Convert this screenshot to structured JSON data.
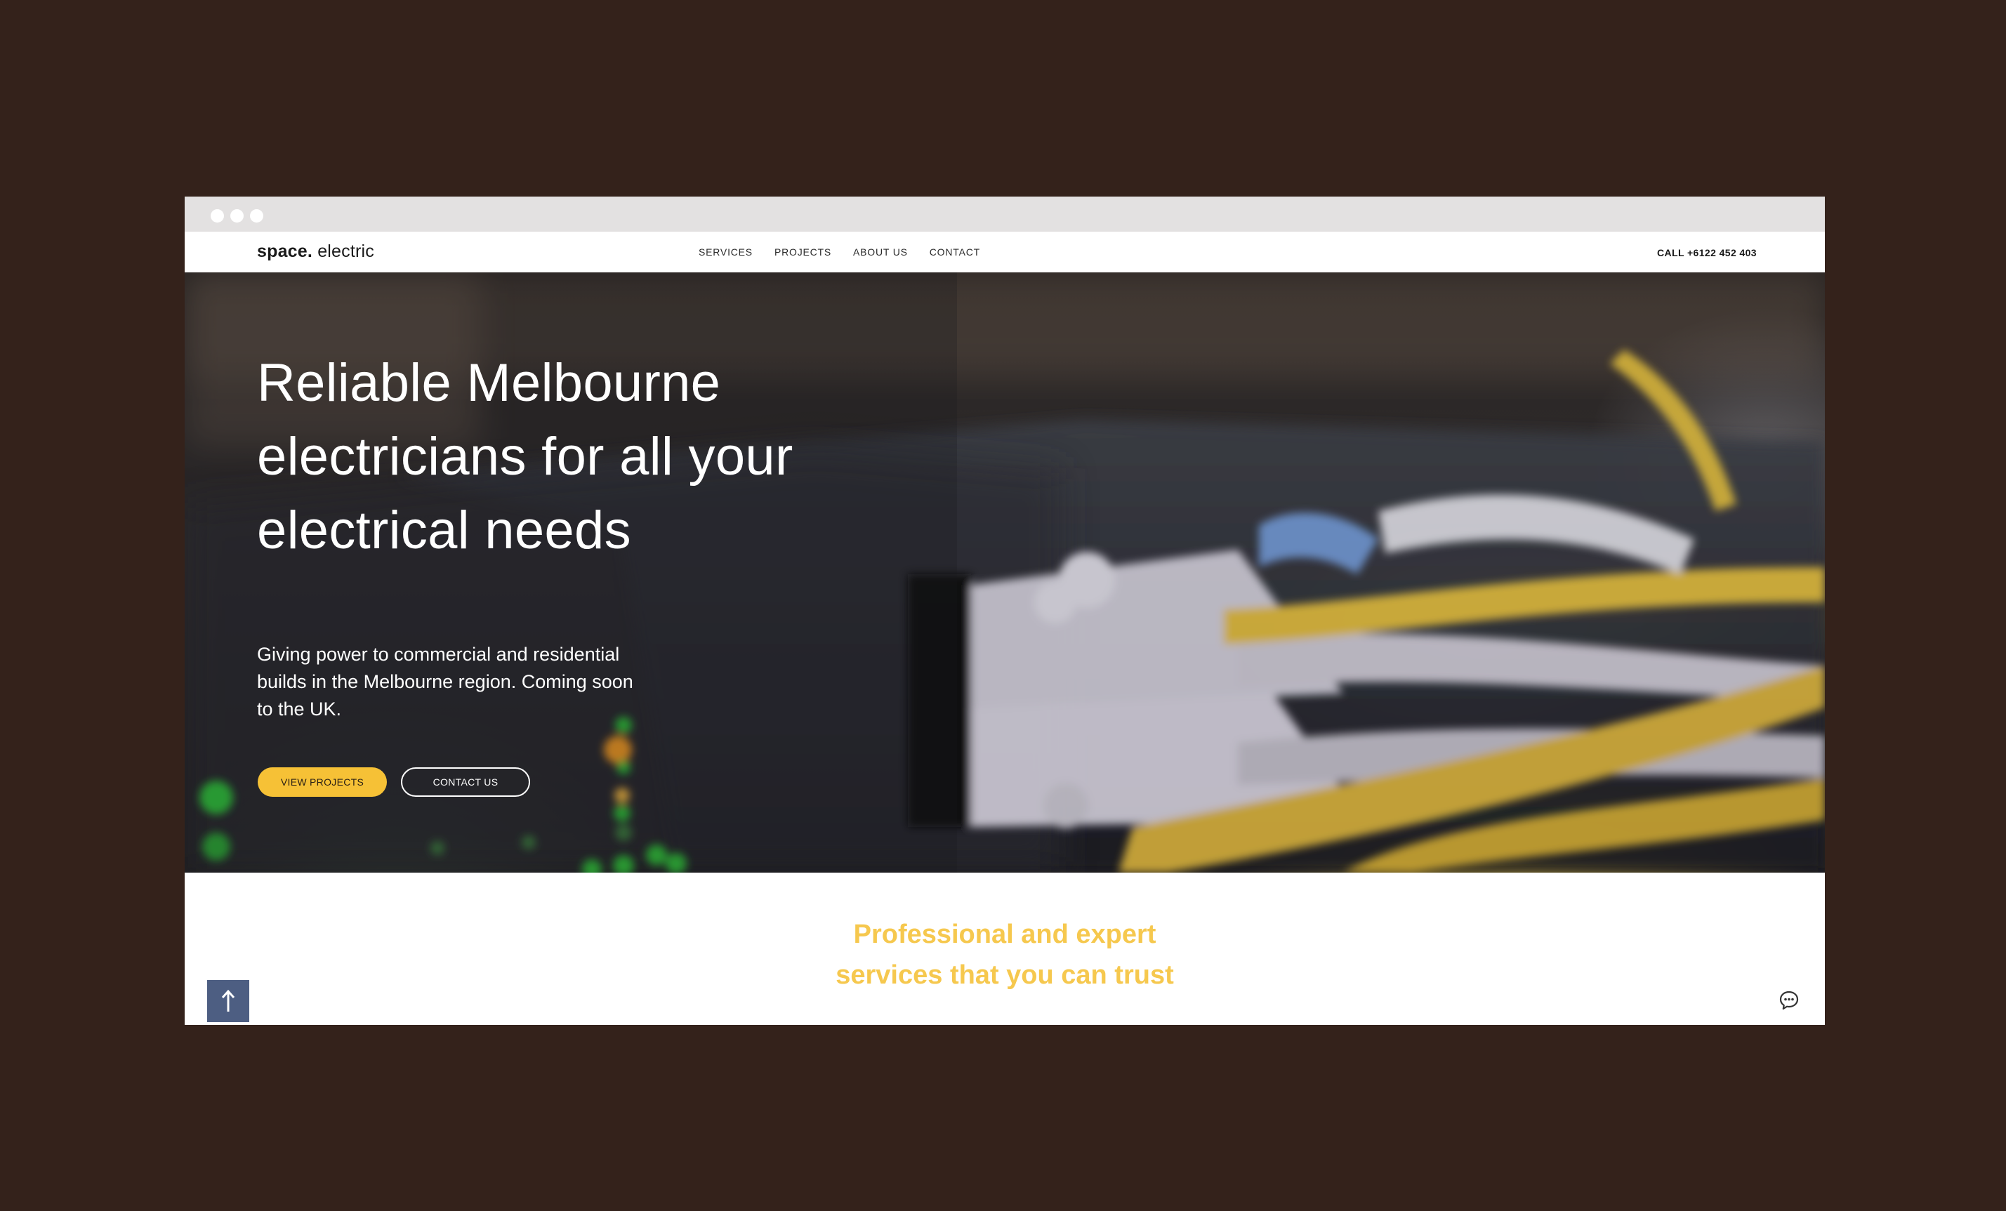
{
  "site": {
    "logo_bold": "space.",
    "logo_light": "electric",
    "nav": [
      "SERVICES",
      "PROJECTS",
      "ABOUT US",
      "CONTACT"
    ],
    "phone": "CALL +6122 452 403"
  },
  "hero": {
    "title_lines": [
      "Reliable Melbourne",
      "electricians for all your",
      "electrical needs"
    ],
    "subtitle_lines": [
      "Giving power to commercial and residential",
      "builds in the Melbourne region. Coming soon",
      "to the UK."
    ],
    "primary_button": "VIEW PROJECTS",
    "secondary_button": "CONTACT US",
    "background_image": "ethernet-cables-network-switch"
  },
  "section": {
    "heading_lines": [
      "Professional and expert",
      "services that you can trust"
    ]
  },
  "icons": {
    "back_to_top": "arrow-up-icon",
    "chat": "chat-bubble-icon"
  },
  "colors": {
    "page_background": "#34221b",
    "accent": "#f6c136",
    "heading_accent": "#f6c84e",
    "back_to_top_bg": "#4d5e82",
    "chrome_bar": "#e3e1e1"
  }
}
